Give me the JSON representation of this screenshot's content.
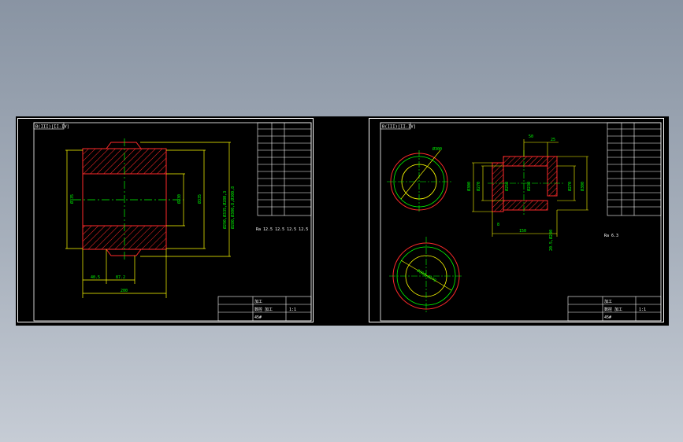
{
  "colors": {
    "background": "#000000",
    "sheet_border": "#ffffff",
    "outline": "#ff2a2a",
    "hatch": "#ff2a2a",
    "dimension": "#ffff00",
    "centerline": "#00ff00",
    "text": "#ffffff",
    "dim_text": "#ffff00",
    "green_text": "#00ff00"
  },
  "sheet1": {
    "header": "B(III)[II-IV]",
    "dims": {
      "bottom_total": "200",
      "bottom_left": "40.5",
      "bottom_mid": "87.2",
      "left_dia": "Ø335",
      "inner_dia": "Ø230",
      "right_dia": "Ø335",
      "far_right_1": "Ø290,Ø335,Ø280,3",
      "far_right_2": "Ø280,Ø300,8,Ø300,8"
    },
    "note": "Ra 12.5  12.5  12.5  12.5",
    "title_block": {
      "line1": "加工",
      "line2": "数控 加工",
      "line3": "1:1",
      "line4": "45#"
    }
  },
  "sheet2": {
    "header": "B(III)[II-IV]",
    "dims": {
      "top_a": "50",
      "top_b": "25",
      "left_1": "Ø300",
      "left_2": "Ø270",
      "mid_1": "Ø250",
      "mid_2": "Ø230",
      "right_1": "Ø270",
      "right_2": "Ø300",
      "bottom_1": "8",
      "bottom_2": "150",
      "bottom_3": "20.5,Ø240",
      "circle_1": "Ø300",
      "circle_2": "Ø300,Ø270"
    },
    "note": "Ra 6.3",
    "title_block": {
      "line1": "加工",
      "line2": "数控 加工",
      "line3": "1:1",
      "line4": "45#"
    }
  }
}
